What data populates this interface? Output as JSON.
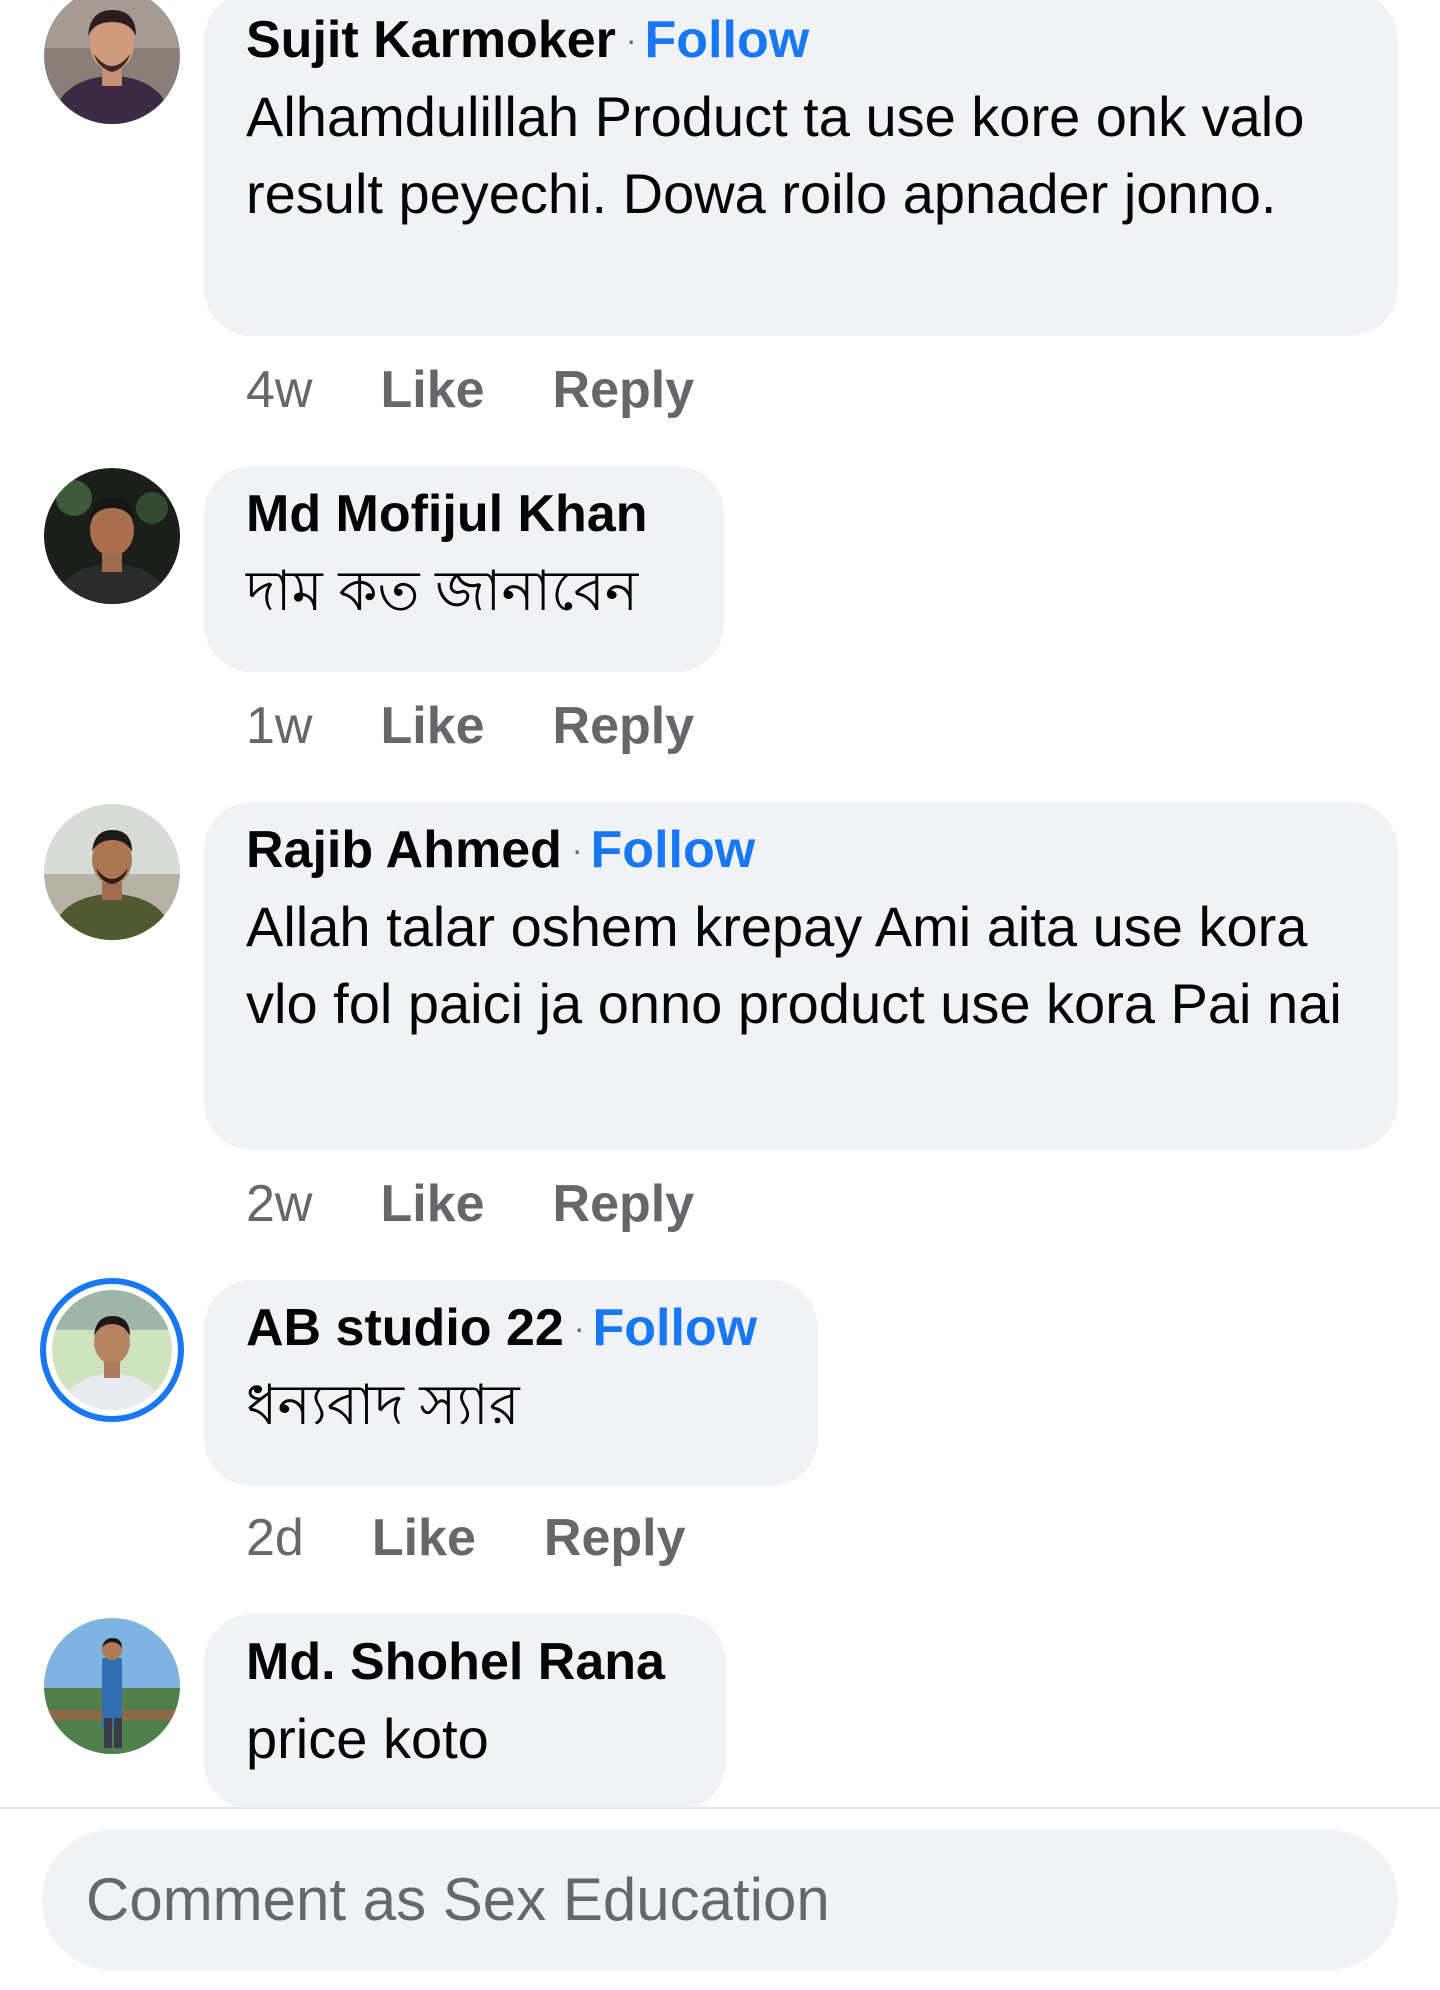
{
  "comments": [
    {
      "author": "Sujit Karmoker",
      "follow_label": "Follow",
      "text": "Alhamdulillah Product ta use kore onk valo result peyechi. Dowa roilo apnader jonno.",
      "time": "4w",
      "like_label": "Like",
      "reply_label": "Reply"
    },
    {
      "author": "Md Mofijul Khan",
      "text": "দাম কত জানাবেন",
      "time": "1w",
      "like_label": "Like",
      "reply_label": "Reply"
    },
    {
      "author": "Rajib Ahmed",
      "follow_label": "Follow",
      "text": "Allah talar oshem krepay Ami aita use kora vlo fol paici ja onno product use kora Pai nai",
      "time": "2w",
      "like_label": "Like",
      "reply_label": "Reply"
    },
    {
      "author": "AB studio 22",
      "follow_label": "Follow",
      "text": "ধন্যবাদ স্যার",
      "time": "2d",
      "like_label": "Like",
      "reply_label": "Reply"
    },
    {
      "author": "Md. Shohel Rana",
      "text": "price koto"
    }
  ],
  "composer": {
    "placeholder": "Comment as Sex Education"
  },
  "colors": {
    "bubble": "#f0f2f5",
    "link_blue": "#1877f2",
    "secondary_text": "#65676b",
    "primary_text": "#050505"
  },
  "icons": [
    "avatar-photo"
  ]
}
